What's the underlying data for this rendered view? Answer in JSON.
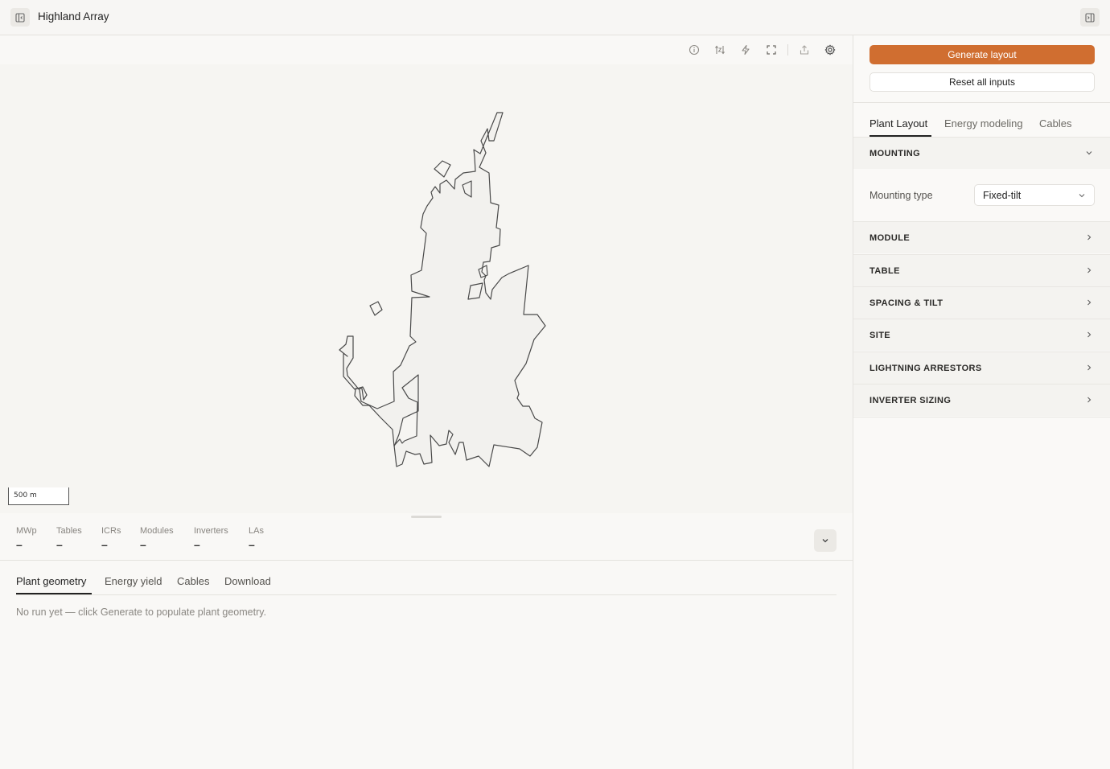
{
  "header": {
    "title": "Highland Array",
    "left_toggle_icon": "sidebar-left-icon",
    "right_toggle_icon": "sidebar-right-icon"
  },
  "toolbar": {
    "icons": [
      "info-icon",
      "compare-icon",
      "lightning-icon",
      "fullscreen-icon",
      "share-icon",
      "settings-icon"
    ]
  },
  "map": {
    "scale_label": "500 m",
    "outline_color": "#4a4a4a",
    "fill_color": "#f2f1ee"
  },
  "stats": [
    {
      "label": "MWp",
      "value": "–"
    },
    {
      "label": "Tables",
      "value": "–"
    },
    {
      "label": "ICRs",
      "value": "–"
    },
    {
      "label": "Modules",
      "value": "–"
    },
    {
      "label": "Inverters",
      "value": "–"
    },
    {
      "label": "LAs",
      "value": "–"
    }
  ],
  "bottom_tabs": {
    "items": [
      "Plant geometry",
      "Energy yield",
      "Cables",
      "Download"
    ],
    "active": "Plant geometry",
    "empty_message": "No run yet — click Generate to populate plant geometry."
  },
  "panel": {
    "generate_label": "Generate layout",
    "reset_label": "Reset all inputs",
    "accent_color": "#d06e30",
    "tabs": [
      "Plant Layout",
      "Energy modeling",
      "Cables"
    ],
    "active_tab": "Plant Layout",
    "sections": [
      {
        "label": "MOUNTING",
        "expanded": true
      },
      {
        "label": "MODULE",
        "expanded": false
      },
      {
        "label": "TABLE",
        "expanded": false
      },
      {
        "label": "SPACING & TILT",
        "expanded": false
      },
      {
        "label": "SITE",
        "expanded": false
      },
      {
        "label": "LIGHTNING ARRESTORS",
        "expanded": false
      },
      {
        "label": "INVERTER SIZING",
        "expanded": false
      }
    ],
    "mounting": {
      "field_label": "Mounting type",
      "selected": "Fixed-tilt"
    }
  }
}
